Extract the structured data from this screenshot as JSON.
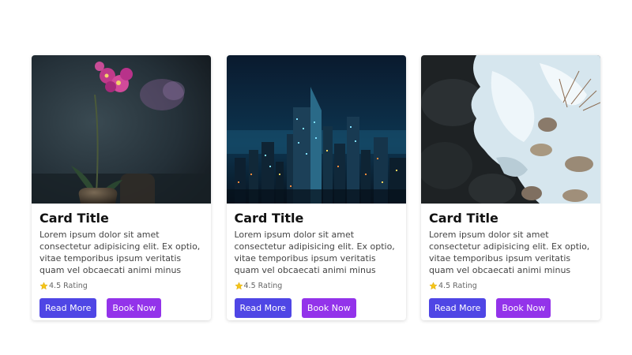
{
  "cards": [
    {
      "image": "orchid-in-vase-photo",
      "title": "Card Title",
      "text": "Lorem ipsum dolor sit amet consectetur adipisicing elit. Ex optio, vitae temporibus ipsum veritatis quam vel obcaecati animi minus molestiae.",
      "rating_icon": "star-icon",
      "rating": "4.5 Rating",
      "read_more": "Read More",
      "book_now": "Book Now"
    },
    {
      "image": "city-skyline-night-photo",
      "title": "Card Title",
      "text": "Lorem ipsum dolor sit amet consectetur adipisicing elit. Ex optio, vitae temporibus ipsum veritatis quam vel obcaecati animi minus molestiae.",
      "rating_icon": "star-icon",
      "rating": "4.5 Rating",
      "read_more": "Read More",
      "book_now": "Book Now"
    },
    {
      "image": "ice-on-rocks-photo",
      "title": "Card Title",
      "text": "Lorem ipsum dolor sit amet consectetur adipisicing elit. Ex optio, vitae temporibus ipsum veritatis quam vel obcaecati animi minus molestiae.",
      "rating_icon": "star-icon",
      "rating": "4.5 Rating",
      "read_more": "Read More",
      "book_now": "Book Now"
    }
  ],
  "colors": {
    "read_more_button": "#4f46e5",
    "book_now_button": "#9333ea",
    "star": "#f5c518"
  }
}
